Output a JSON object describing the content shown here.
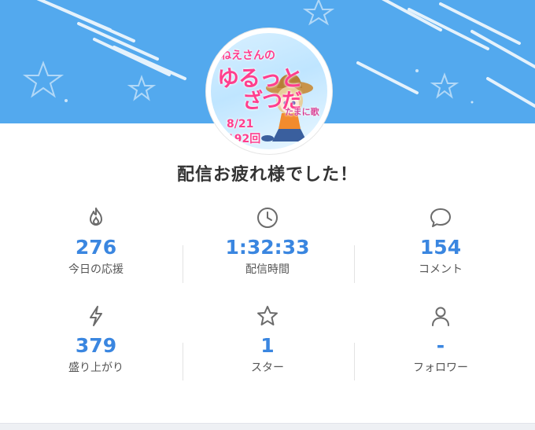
{
  "banner": {
    "background_color": "#53a9ee",
    "thumbnail": {
      "line1": "ねえさんの",
      "line2": "ゆるっと",
      "line3": "ざつだ",
      "line4": "たまに歌",
      "date": "8/21",
      "episode": "192回"
    }
  },
  "heading": "配信お疲れ様でした！",
  "stats": [
    {
      "icon": "flame-icon",
      "value": "276",
      "label": "今日の応援"
    },
    {
      "icon": "clock-icon",
      "value": "1:32:33",
      "label": "配信時間"
    },
    {
      "icon": "comment-icon",
      "value": "154",
      "label": "コメント"
    },
    {
      "icon": "lightning-icon",
      "value": "379",
      "label": "盛り上がり"
    },
    {
      "icon": "star-icon",
      "value": "1",
      "label": "スター"
    },
    {
      "icon": "person-icon",
      "value": "-",
      "label": "フォロワー"
    }
  ],
  "colors": {
    "value_blue": "#3a86e0",
    "icon_gray": "#6b6b6b"
  }
}
